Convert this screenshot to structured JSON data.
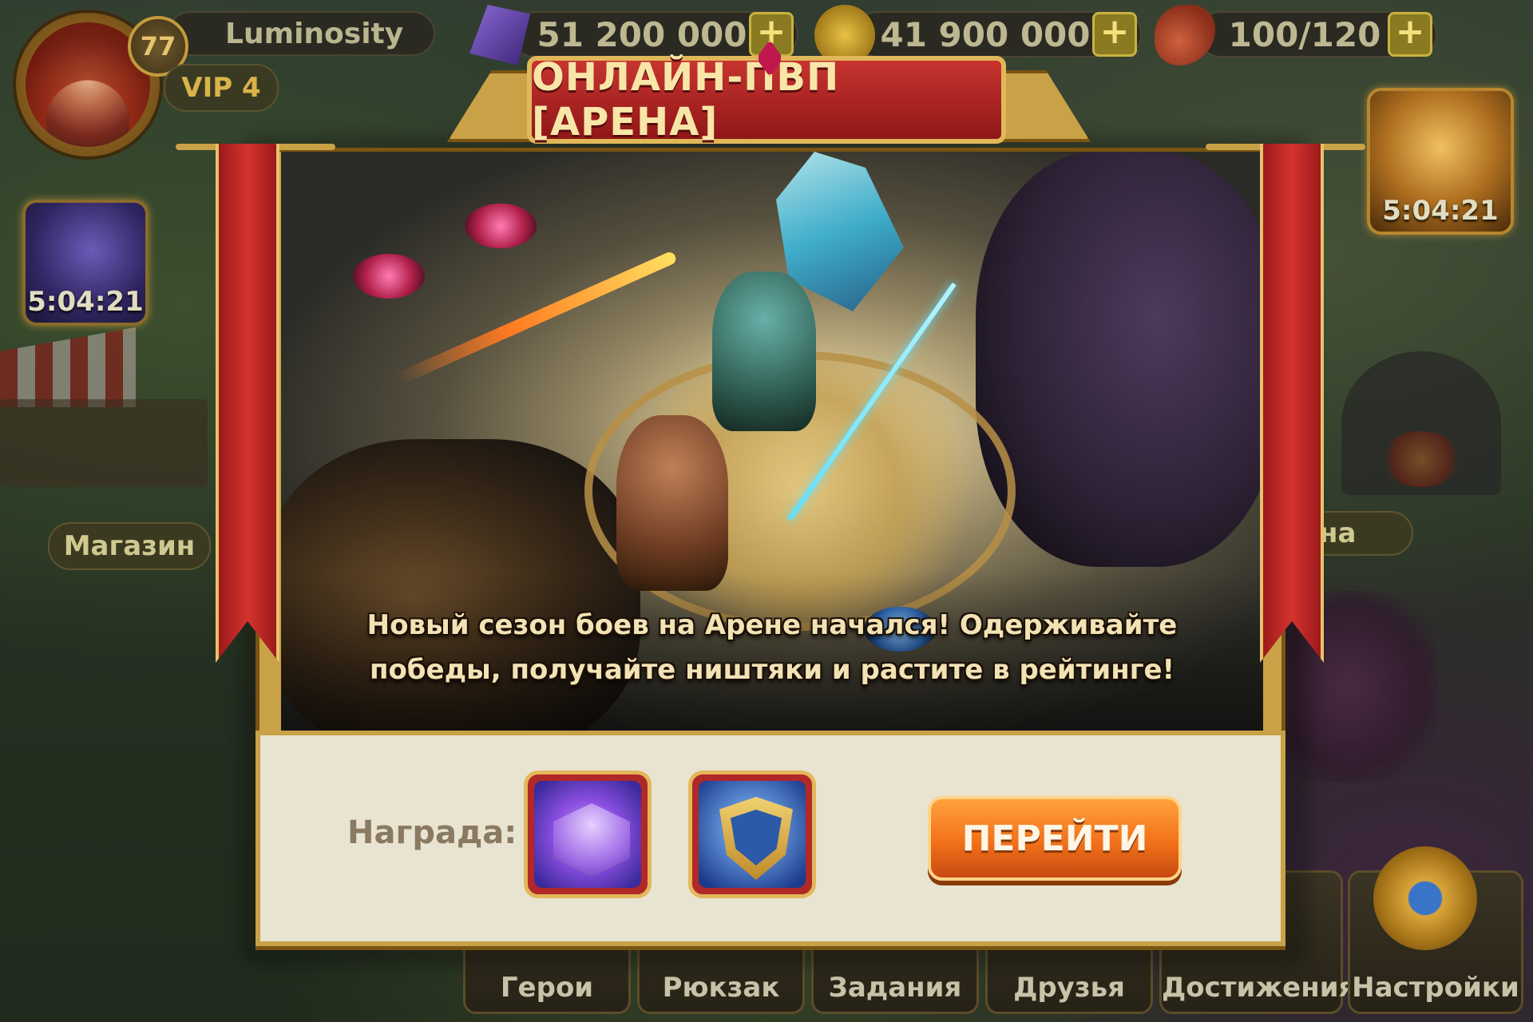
{
  "player": {
    "level": "77",
    "name": "Luminosity",
    "vip": "VIP 4"
  },
  "resources": {
    "gems": "51 200 000",
    "gold": "41 900 000",
    "stamina": "100/120",
    "plus": "+"
  },
  "side_timers": {
    "left": "5:04:21",
    "right": "5:04:21"
  },
  "map_labels": {
    "shop": "Магазин",
    "arena_partial": "на"
  },
  "bottom_menu": [
    {
      "label": "Герои"
    },
    {
      "label": "Рюкзак"
    },
    {
      "label": "Задания"
    },
    {
      "label": "Друзья"
    },
    {
      "label": "Достижения"
    },
    {
      "label": "Настройки"
    }
  ],
  "modal": {
    "title": "ОНЛАЙН-ПВП [АРЕНА]",
    "description_line1": "Новый сезон боев на Арене начался! Одерживайте",
    "description_line2": "победы, получайте ништяки и растите в рейтинге!",
    "reward_label": "Награда:",
    "go_button": "ПЕРЕЙТИ"
  },
  "icons": {
    "gem": "gem-icon",
    "coin": "coin-icon",
    "meat": "meat-icon",
    "reward1": "purple-gems-icon",
    "reward2": "arena-shield-icon"
  },
  "colors": {
    "accent_red": "#c7342f",
    "gold_frame": "#c9a247",
    "button_orange": "#f2711a"
  }
}
